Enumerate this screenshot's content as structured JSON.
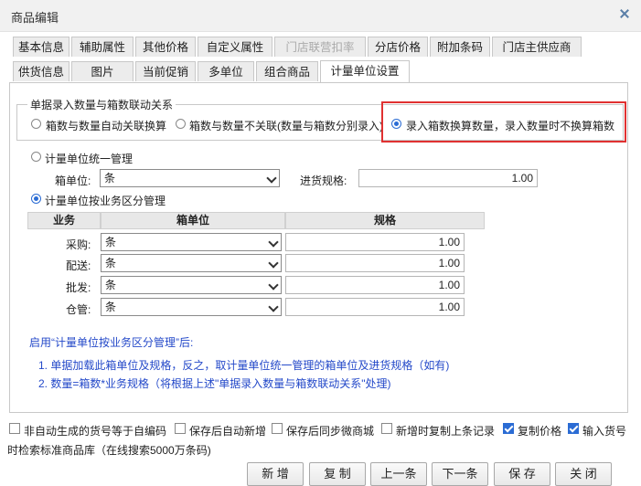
{
  "window": {
    "title": "商品编辑"
  },
  "tabs_row1": [
    {
      "label": "基本信息"
    },
    {
      "label": "辅助属性"
    },
    {
      "label": "其他价格"
    },
    {
      "label": "自定义属性"
    },
    {
      "label": "门店联营扣率"
    },
    {
      "label": "分店价格"
    },
    {
      "label": "附加条码"
    },
    {
      "label": "门店主供应商"
    }
  ],
  "tabs_row2": [
    {
      "label": "供货信息"
    },
    {
      "label": "图片"
    },
    {
      "label": "当前促销"
    },
    {
      "label": "多单位"
    },
    {
      "label": "组合商品"
    },
    {
      "label": "计量单位设置"
    }
  ],
  "linkage": {
    "legend": "单据录入数量与箱数联动关系",
    "options": [
      {
        "label": "箱数与数量自动关联换算",
        "checked": false
      },
      {
        "label": "箱数与数量不关联(数量与箱数分别录入)",
        "checked": false
      },
      {
        "label": "录入箱数换算数量，录入数量时不换算箱数",
        "checked": true
      }
    ]
  },
  "unified": {
    "label": "计量单位统一管理",
    "box_unit_label": "箱单位:",
    "box_unit_value": "条",
    "spec_label": "进货规格:",
    "spec_value": "1.00"
  },
  "by_business": {
    "label": "计量单位按业务区分管理",
    "headers": [
      "业务",
      "箱单位",
      "规格"
    ],
    "rows": [
      {
        "business": "采购:",
        "unit": "条",
        "spec": "1.00"
      },
      {
        "business": "配送:",
        "unit": "条",
        "spec": "1.00"
      },
      {
        "business": "批发:",
        "unit": "条",
        "spec": "1.00"
      },
      {
        "business": "仓管:",
        "unit": "条",
        "spec": "1.00"
      }
    ]
  },
  "notes": {
    "heading": "启用“计量单位按业务区分管理”后:",
    "line1": "1. 单据加载此箱单位及规格，反之，取计量单位统一管理的箱单位及进货规格（如有)",
    "line2": "2. 数量=箱数*业务规格（将根据上述\"单据录入数量与箱数联动关系\"处理)"
  },
  "footer_checks": [
    {
      "label": "非自动生成的货号等于自编码",
      "checked": false
    },
    {
      "label": "保存后自动新增",
      "checked": false
    },
    {
      "label": "保存后同步微商城",
      "checked": false
    },
    {
      "label": "新增时复制上条记录",
      "checked": false
    },
    {
      "label": "复制价格",
      "checked": true
    },
    {
      "label": "输入货号",
      "checked": true
    }
  ],
  "footer_line2": "时检索标准商品库（在线搜索5000万条码)",
  "buttons": {
    "new": "新 增",
    "copy": "复 制",
    "prev": "上一条",
    "next": "下一条",
    "save": "保 存",
    "close": "关 闭"
  },
  "colors": {
    "accent": "#2b6cd4",
    "note": "#2449c9",
    "highlight": "#e03131"
  }
}
